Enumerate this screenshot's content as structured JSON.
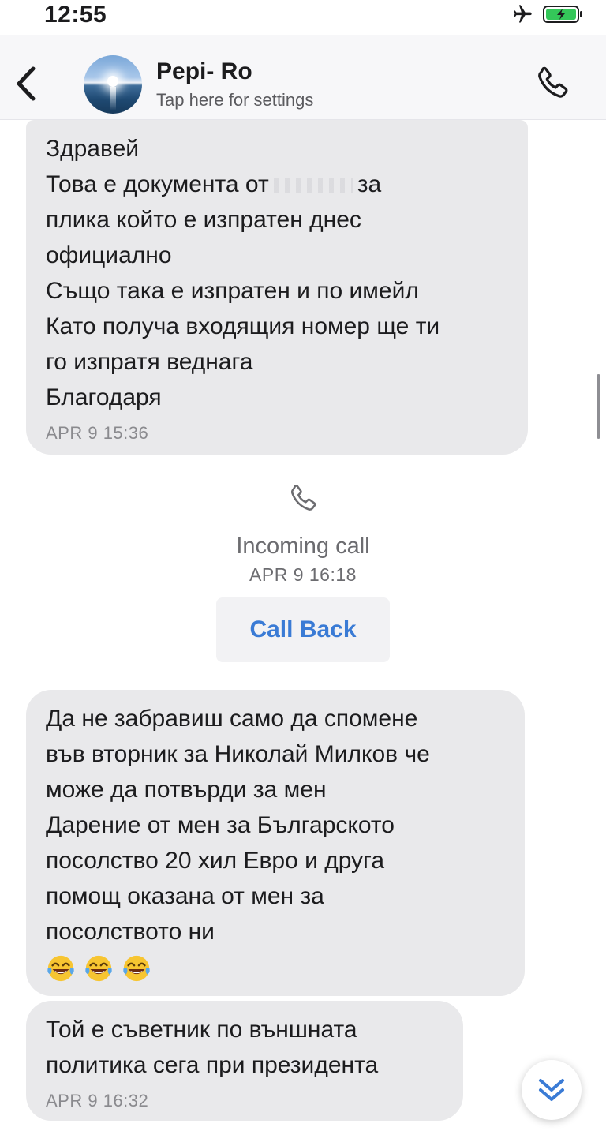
{
  "status_bar": {
    "time": "12:55",
    "icons": [
      "airplane-icon",
      "battery-charging-icon"
    ]
  },
  "header": {
    "contact_name": "Pepi- Ro",
    "subtitle": "Tap here for settings",
    "back_icon": "chevron-left-icon",
    "call_icon": "phone-icon"
  },
  "messages": [
    {
      "lines": [
        "Здравей",
        "Това е документа от",
        "за",
        "плика който е изпратен днес",
        "официално",
        "Също така е изпратен и по имейл",
        "Като получа входящия номер ще ти",
        "го изпратя веднага",
        "Благодаря"
      ],
      "time": "APR 9 15:36"
    },
    {
      "lines": [
        "Да не забравиш само да спомене",
        "във вторник за Николай Милков че",
        "може да потвърди за мен",
        "Дарение от мен за Българското",
        "посолство 20 хил Евро и друга",
        "помощ оказана от мен за",
        "посолството ни"
      ],
      "emoji": [
        "laughing-tears-emoji",
        "laughing-tears-emoji",
        "laughing-tears-emoji"
      ]
    },
    {
      "lines": [
        "Той е съветник по външната",
        "политика сега при президента"
      ],
      "time": "APR 9 16:32"
    }
  ],
  "call_event": {
    "icon": "phone-icon",
    "label": "Incoming call",
    "time": "APR 9 16:18",
    "call_back_label": "Call Back"
  },
  "colors": {
    "accent": "#3a7bd5",
    "bubble": "#e9e9eb",
    "header_bg": "#f7f7f9",
    "battery_green": "#34c759"
  },
  "scroll_down_icon": "double-chevron-down-icon"
}
